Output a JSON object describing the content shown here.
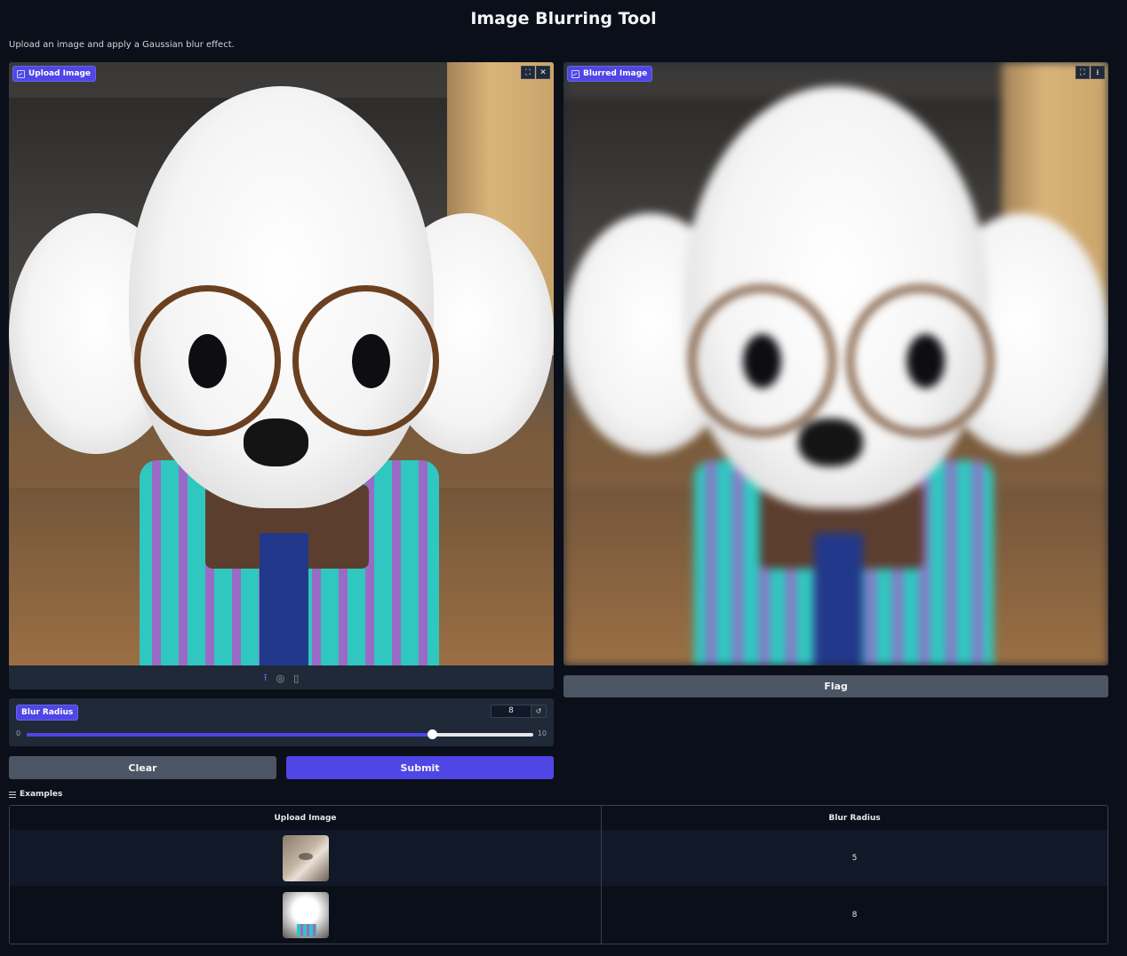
{
  "page": {
    "title": "Image Blurring Tool",
    "description": "Upload an image and apply a Gaussian blur effect."
  },
  "input_image": {
    "label": "Upload Image",
    "fullscreen_icon": "fullscreen-icon",
    "clear_icon": "close-icon",
    "toolbar_icons": [
      "upload-icon",
      "webcam-icon",
      "clipboard-icon"
    ]
  },
  "output_image": {
    "label": "Blurred Image",
    "fullscreen_icon": "fullscreen-icon",
    "download_icon": "download-icon"
  },
  "slider": {
    "label": "Blur Radius",
    "value": "8",
    "min": "0",
    "max": "10",
    "value_fraction": 0.8
  },
  "buttons": {
    "clear": "Clear",
    "submit": "Submit",
    "flag": "Flag"
  },
  "examples": {
    "heading": "Examples",
    "headers": [
      "Upload Image",
      "Blur Radius"
    ],
    "rows": [
      {
        "image": "cat-thumbnail",
        "radius": "5"
      },
      {
        "image": "dog-thumbnail",
        "radius": "8"
      }
    ]
  },
  "colors": {
    "background": "#0b0f19",
    "panel": "#1f2937",
    "accent": "#4f46e5",
    "secondary_button": "#4b5563"
  }
}
